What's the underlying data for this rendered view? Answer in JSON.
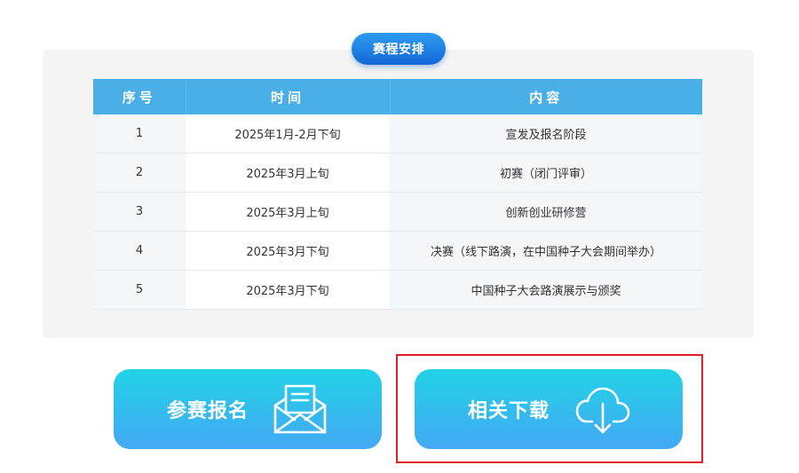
{
  "section": {
    "title": "赛程安排"
  },
  "table": {
    "headers": [
      "序号",
      "时间",
      "内容"
    ],
    "rows": [
      {
        "no": "1",
        "time": "2025年1月-2月下旬",
        "content": "宣发及报名阶段"
      },
      {
        "no": "2",
        "time": "2025年3月上旬",
        "content": "初赛（闭门评审）"
      },
      {
        "no": "3",
        "time": "2025年3月上旬",
        "content": "创新创业研修营"
      },
      {
        "no": "4",
        "time": "2025年3月下旬",
        "content": "决赛（线下路演，在中国种子大会期间举办）"
      },
      {
        "no": "5",
        "time": "2025年3月下旬",
        "content": "中国种子大会路演展示与颁奖"
      }
    ]
  },
  "buttons": {
    "signup_label": "参赛报名",
    "signup_icon": "envelope-icon",
    "download_label": "相关下载",
    "download_icon": "cloud-download-icon"
  },
  "colors": {
    "header_blue": "#4aafe6",
    "pill_blue": "#1367d6",
    "button_gradient_top": "#22d2e6",
    "button_gradient_bottom": "#43a8f4",
    "highlight_red": "#e02020"
  }
}
